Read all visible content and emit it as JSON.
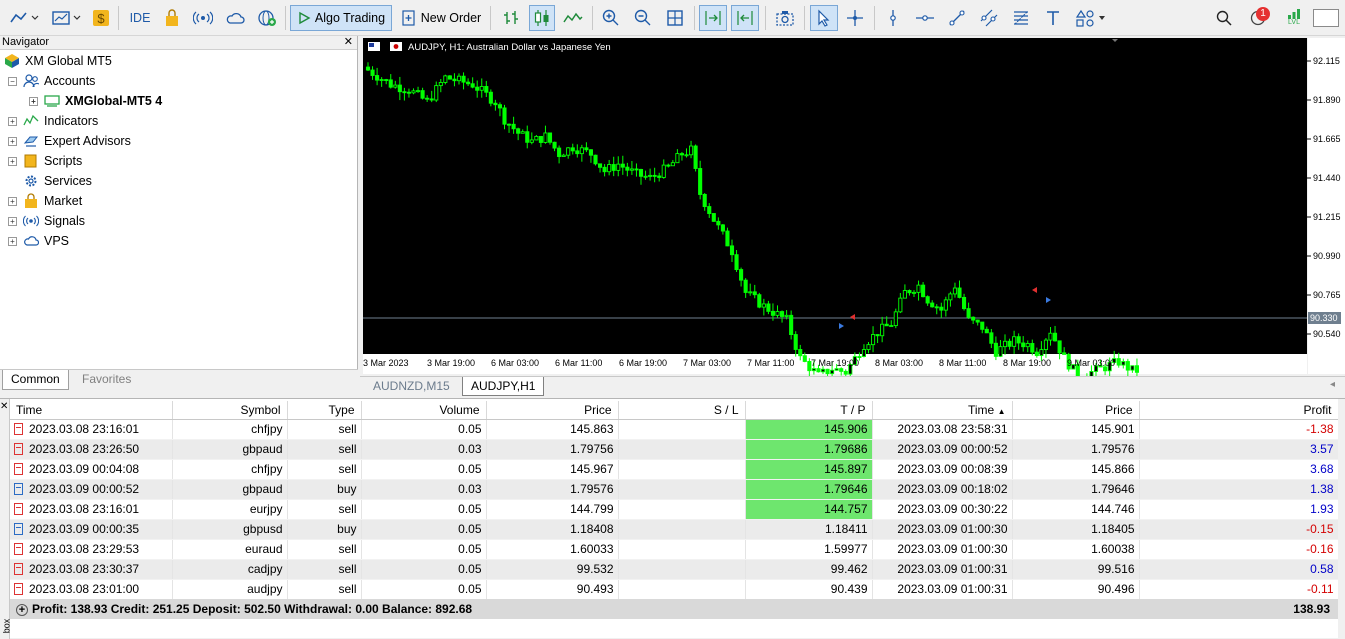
{
  "toolbar": {
    "ide_label": "IDE",
    "algo_trading_label": "Algo Trading",
    "new_order_label": "New Order",
    "notification_count": "1",
    "lvl_label": "LVL"
  },
  "navigator": {
    "title": "Navigator",
    "root": "XM Global MT5",
    "items": [
      {
        "label": "Accounts"
      },
      {
        "label": "XMGlobal-MT5 4"
      },
      {
        "label": "Indicators"
      },
      {
        "label": "Expert Advisors"
      },
      {
        "label": "Scripts"
      },
      {
        "label": "Services"
      },
      {
        "label": "Market"
      },
      {
        "label": "Signals"
      },
      {
        "label": "VPS"
      }
    ],
    "tabs": [
      "Common",
      "Favorites"
    ]
  },
  "chart": {
    "header": "AUDJPY, H1:  Australian Dollar vs Japanese Yen",
    "price_labels": [
      "92.115",
      "91.890",
      "91.665",
      "91.440",
      "91.215",
      "90.990",
      "90.765",
      "90.540"
    ],
    "current_price": "90.330",
    "time_labels": [
      "3 Mar 2023",
      "3 Mar 19:00",
      "6 Mar 03:00",
      "6 Mar 11:00",
      "6 Mar 19:00",
      "7 Mar 03:00",
      "7 Mar 11:00",
      "7 Mar 19:00",
      "8 Mar 03:00",
      "8 Mar 11:00",
      "8 Mar 19:00",
      "9 Mar 03:00"
    ],
    "colors": {
      "background": "#000000",
      "candle": "#00ff00",
      "bid_line": "#6f7f8f"
    }
  },
  "chart_tabs": [
    "AUDNZD,M15",
    "AUDJPY,H1"
  ],
  "deals": {
    "columns": [
      "Time",
      "Symbol",
      "Type",
      "Volume",
      "Price",
      "S / L",
      "T / P",
      "Time",
      "Price",
      "Profit"
    ],
    "rows": [
      {
        "open_time": "2023.03.08 23:16:01",
        "symbol": "chfjpy",
        "type": "sell",
        "volume": "0.05",
        "price": "145.863",
        "sl": "",
        "tp": "145.906",
        "close_time": "2023.03.08 23:58:31",
        "close_price": "145.901",
        "profit": "-1.38"
      },
      {
        "open_time": "2023.03.08 23:26:50",
        "symbol": "gbpaud",
        "type": "sell",
        "volume": "0.03",
        "price": "1.79756",
        "sl": "",
        "tp": "1.79686",
        "close_time": "2023.03.09 00:00:52",
        "close_price": "1.79576",
        "profit": "3.57"
      },
      {
        "open_time": "2023.03.09 00:04:08",
        "symbol": "chfjpy",
        "type": "sell",
        "volume": "0.05",
        "price": "145.967",
        "sl": "",
        "tp": "145.897",
        "close_time": "2023.03.09 00:08:39",
        "close_price": "145.866",
        "profit": "3.68"
      },
      {
        "open_time": "2023.03.09 00:00:52",
        "symbol": "gbpaud",
        "type": "buy",
        "volume": "0.03",
        "price": "1.79576",
        "sl": "",
        "tp": "1.79646",
        "close_time": "2023.03.09 00:18:02",
        "close_price": "1.79646",
        "profit": "1.38"
      },
      {
        "open_time": "2023.03.08 23:16:01",
        "symbol": "eurjpy",
        "type": "sell",
        "volume": "0.05",
        "price": "144.799",
        "sl": "",
        "tp": "144.757",
        "close_time": "2023.03.09 00:30:22",
        "close_price": "144.746",
        "profit": "1.93"
      },
      {
        "open_time": "2023.03.09 00:00:35",
        "symbol": "gbpusd",
        "type": "buy",
        "volume": "0.05",
        "price": "1.18408",
        "sl": "",
        "tp": "1.18411",
        "close_time": "2023.03.09 01:00:30",
        "close_price": "1.18405",
        "profit": "-0.15"
      },
      {
        "open_time": "2023.03.08 23:29:53",
        "symbol": "euraud",
        "type": "sell",
        "volume": "0.05",
        "price": "1.60033",
        "sl": "",
        "tp": "1.59977",
        "close_time": "2023.03.09 01:00:30",
        "close_price": "1.60038",
        "profit": "-0.16"
      },
      {
        "open_time": "2023.03.08 23:30:37",
        "symbol": "cadjpy",
        "type": "sell",
        "volume": "0.05",
        "price": "99.532",
        "sl": "",
        "tp": "99.462",
        "close_time": "2023.03.09 01:00:31",
        "close_price": "99.516",
        "profit": "0.58"
      },
      {
        "open_time": "2023.03.08 23:01:00",
        "symbol": "audjpy",
        "type": "sell",
        "volume": "0.05",
        "price": "90.493",
        "sl": "",
        "tp": "90.439",
        "close_time": "2023.03.09 01:00:31",
        "close_price": "90.496",
        "profit": "-0.11"
      }
    ],
    "summary": "Profit: 138.93  Credit: 251.25  Deposit: 502.50  Withdrawal: 0.00  Balance: 892.68",
    "summary_profit": "138.93"
  },
  "side_label": "box"
}
